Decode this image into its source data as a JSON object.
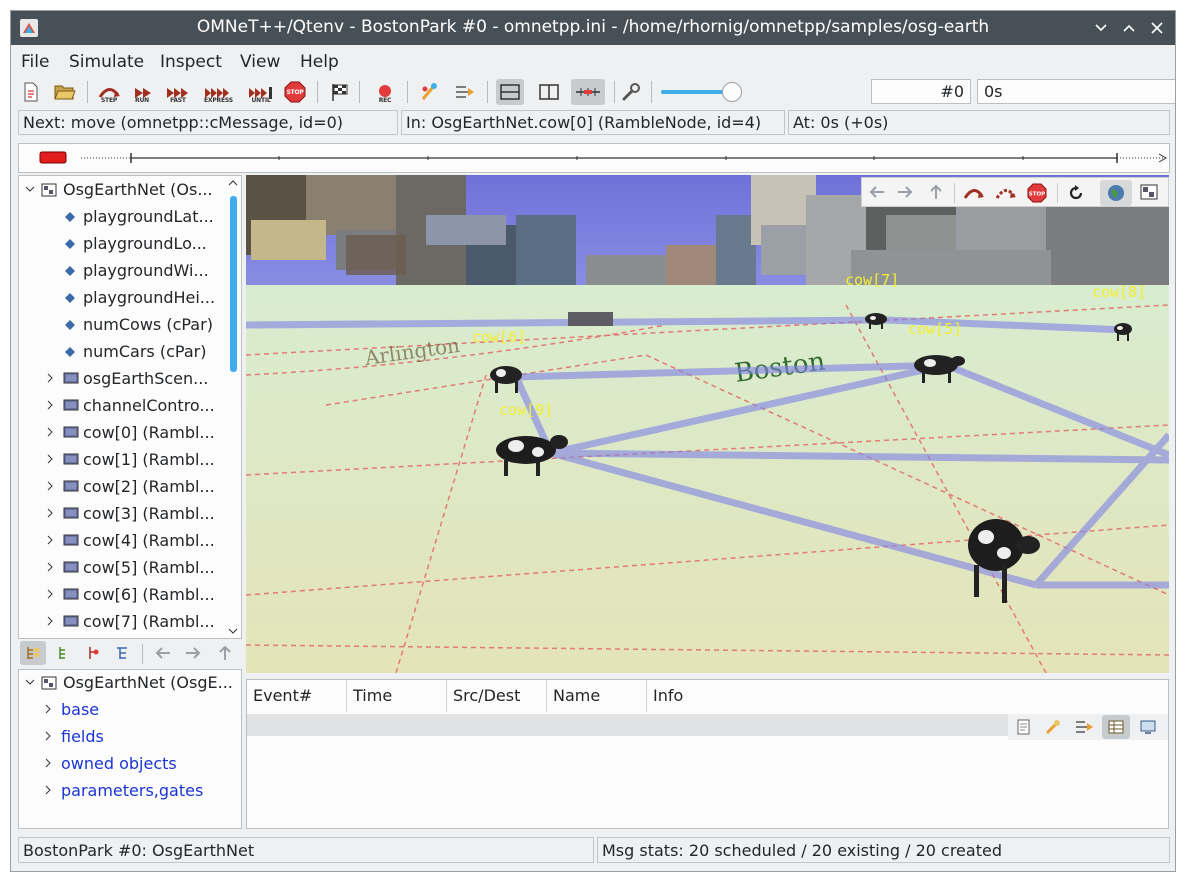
{
  "window": {
    "title": "OMNeT++/Qtenv - BostonPark #0 - omnetpp.ini - /home/rhornig/omnetpp/samples/osg-earth"
  },
  "menu": [
    "File",
    "Simulate",
    "Inspect",
    "View",
    "Help"
  ],
  "toolbar": {
    "step_label": "STEP",
    "run_label": "RUN",
    "fast_label": "FAST",
    "express_label": "EXPRESS",
    "until_label": "UNTIL",
    "stop_label": "STOP",
    "rec_label": "REC",
    "event_number": "#0",
    "sim_time": "0s"
  },
  "status": {
    "next": "Next: move (omnetpp::cMessage, id=0)",
    "in": "In: OsgEarthNet.cow[0] (RambleNode, id=4)",
    "at": "At: 0s (+0s)"
  },
  "object_tree": {
    "root": "OsgEarthNet (Os...",
    "items": [
      {
        "label": "playgroundLat...",
        "kind": "param"
      },
      {
        "label": "playgroundLo...",
        "kind": "param"
      },
      {
        "label": "playgroundWi...",
        "kind": "param"
      },
      {
        "label": "playgroundHei...",
        "kind": "param"
      },
      {
        "label": "numCows (cPar)",
        "kind": "param"
      },
      {
        "label": "numCars (cPar)",
        "kind": "param"
      },
      {
        "label": "osgEarthScen...",
        "kind": "module"
      },
      {
        "label": "channelContro...",
        "kind": "module"
      },
      {
        "label": "cow[0] (Rambl...",
        "kind": "module"
      },
      {
        "label": "cow[1] (Rambl...",
        "kind": "module"
      },
      {
        "label": "cow[2] (Rambl...",
        "kind": "module"
      },
      {
        "label": "cow[3] (Rambl...",
        "kind": "module"
      },
      {
        "label": "cow[4] (Rambl...",
        "kind": "module"
      },
      {
        "label": "cow[5] (Rambl...",
        "kind": "module"
      },
      {
        "label": "cow[6] (Rambl...",
        "kind": "module"
      },
      {
        "label": "cow[7] (Rambl...",
        "kind": "module"
      }
    ]
  },
  "inspector_tree": {
    "root": "OsgEarthNet (OsgE...",
    "items": [
      "base",
      "fields",
      "owned objects",
      "parameters,gates"
    ]
  },
  "scene": {
    "cow_labels": [
      "cow[7]",
      "cow[8]",
      "cow[5]",
      "cow[6]",
      "cow[9]"
    ],
    "map_text": "Boston"
  },
  "log": {
    "columns": [
      "Event#",
      "Time",
      "Src/Dest",
      "Name",
      "Info"
    ]
  },
  "bottom": {
    "left": "BostonPark #0: OsgEarthNet",
    "right": "Msg stats: 20 scheduled / 20 existing / 20 created"
  },
  "colors": {
    "titlebar": "#475057",
    "accent": "#3daee9",
    "link": "#1a35d4",
    "cow_label": "#f2ef30",
    "stop_red": "#e23b3b"
  }
}
